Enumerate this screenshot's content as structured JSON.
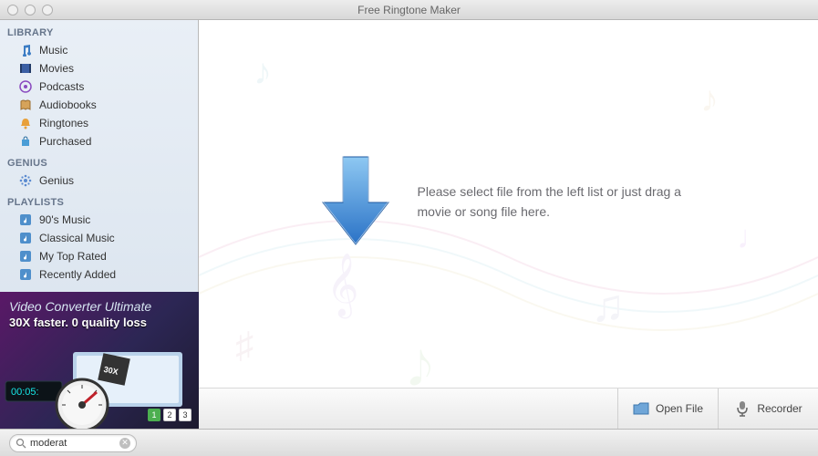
{
  "window": {
    "title": "Free Ringtone Maker"
  },
  "sidebar": {
    "sections": [
      {
        "header": "LIBRARY",
        "items": [
          {
            "label": "Music",
            "icon": "music-note-icon"
          },
          {
            "label": "Movies",
            "icon": "film-icon"
          },
          {
            "label": "Podcasts",
            "icon": "podcast-icon"
          },
          {
            "label": "Audiobooks",
            "icon": "book-icon"
          },
          {
            "label": "Ringtones",
            "icon": "bell-icon"
          },
          {
            "label": "Purchased",
            "icon": "bag-icon"
          }
        ]
      },
      {
        "header": "GENIUS",
        "items": [
          {
            "label": "Genius",
            "icon": "genius-icon"
          }
        ]
      },
      {
        "header": "PLAYLISTS",
        "items": [
          {
            "label": "90's Music",
            "icon": "playlist-icon"
          },
          {
            "label": "Classical Music",
            "icon": "playlist-icon"
          },
          {
            "label": "My Top Rated",
            "icon": "playlist-icon"
          },
          {
            "label": "Recently Added",
            "icon": "playlist-icon"
          }
        ]
      }
    ]
  },
  "dropzone": {
    "text": "Please select file from the left list or just drag a movie or song file here."
  },
  "buttons": {
    "open_file": "Open File",
    "recorder": "Recorder"
  },
  "promo": {
    "title": "Video Converter Ultimate",
    "subtitle": "30X faster. 0 quality loss",
    "pager": [
      "1",
      "2",
      "3"
    ],
    "timer": "00:05:"
  },
  "search": {
    "value": "moderat"
  }
}
